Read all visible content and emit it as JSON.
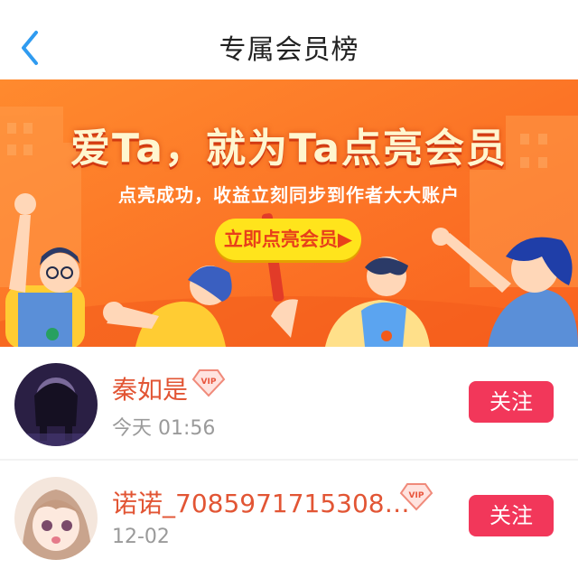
{
  "header": {
    "title": "专属会员榜",
    "back_icon": "chevron-left-icon"
  },
  "banner": {
    "headline": "爱Ta，就为Ta点亮会员",
    "subline": "点亮成功，收益立刻同步到作者大大账户",
    "cta_label": "立即点亮会员"
  },
  "members": [
    {
      "name": "秦如是",
      "time": "今天 01:56",
      "badge": "VIP",
      "follow_label": "关注"
    },
    {
      "name": "诺诺_7085971715308…",
      "time": "12-02",
      "badge": "VIP",
      "follow_label": "关注"
    }
  ],
  "colors": {
    "accent": "#f2375a",
    "name": "#e25534",
    "banner": "#fb7a2c",
    "cta": "#ffe41c",
    "back": "#2f9bf0"
  }
}
